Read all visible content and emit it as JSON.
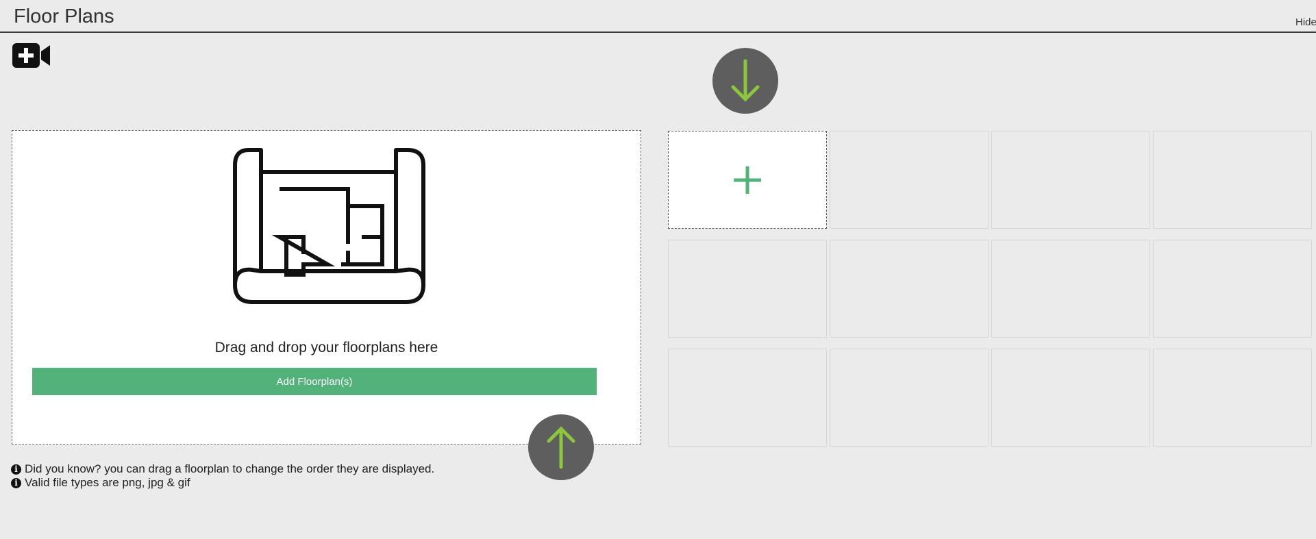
{
  "header": {
    "title": "Floor Plans",
    "hide_label": "Hide"
  },
  "toolbar": {
    "add_video_icon": "add-video-icon"
  },
  "dropzone": {
    "icon": "floorplan-blueprint-icon",
    "text": "Drag and drop your floorplans here",
    "button_label": "Add Floorplan(s)"
  },
  "info": {
    "tip": "Did you know? you can drag a floorplan to change the order they are displayed.",
    "file_types": "Valid file types are png, jpg & gif",
    "icon_glyph": "i"
  },
  "grid": {
    "columns": 4,
    "rows": 3,
    "add_icon": "plus-icon"
  },
  "annotations": {
    "arrow_down_icon": "arrow-down-icon",
    "arrow_up_icon": "arrow-up-icon"
  },
  "colors": {
    "accent_green": "#52b27a",
    "arrow_green": "#8cc63f",
    "arrow_circle": "#5e5e5e",
    "background": "#ebebeb"
  }
}
